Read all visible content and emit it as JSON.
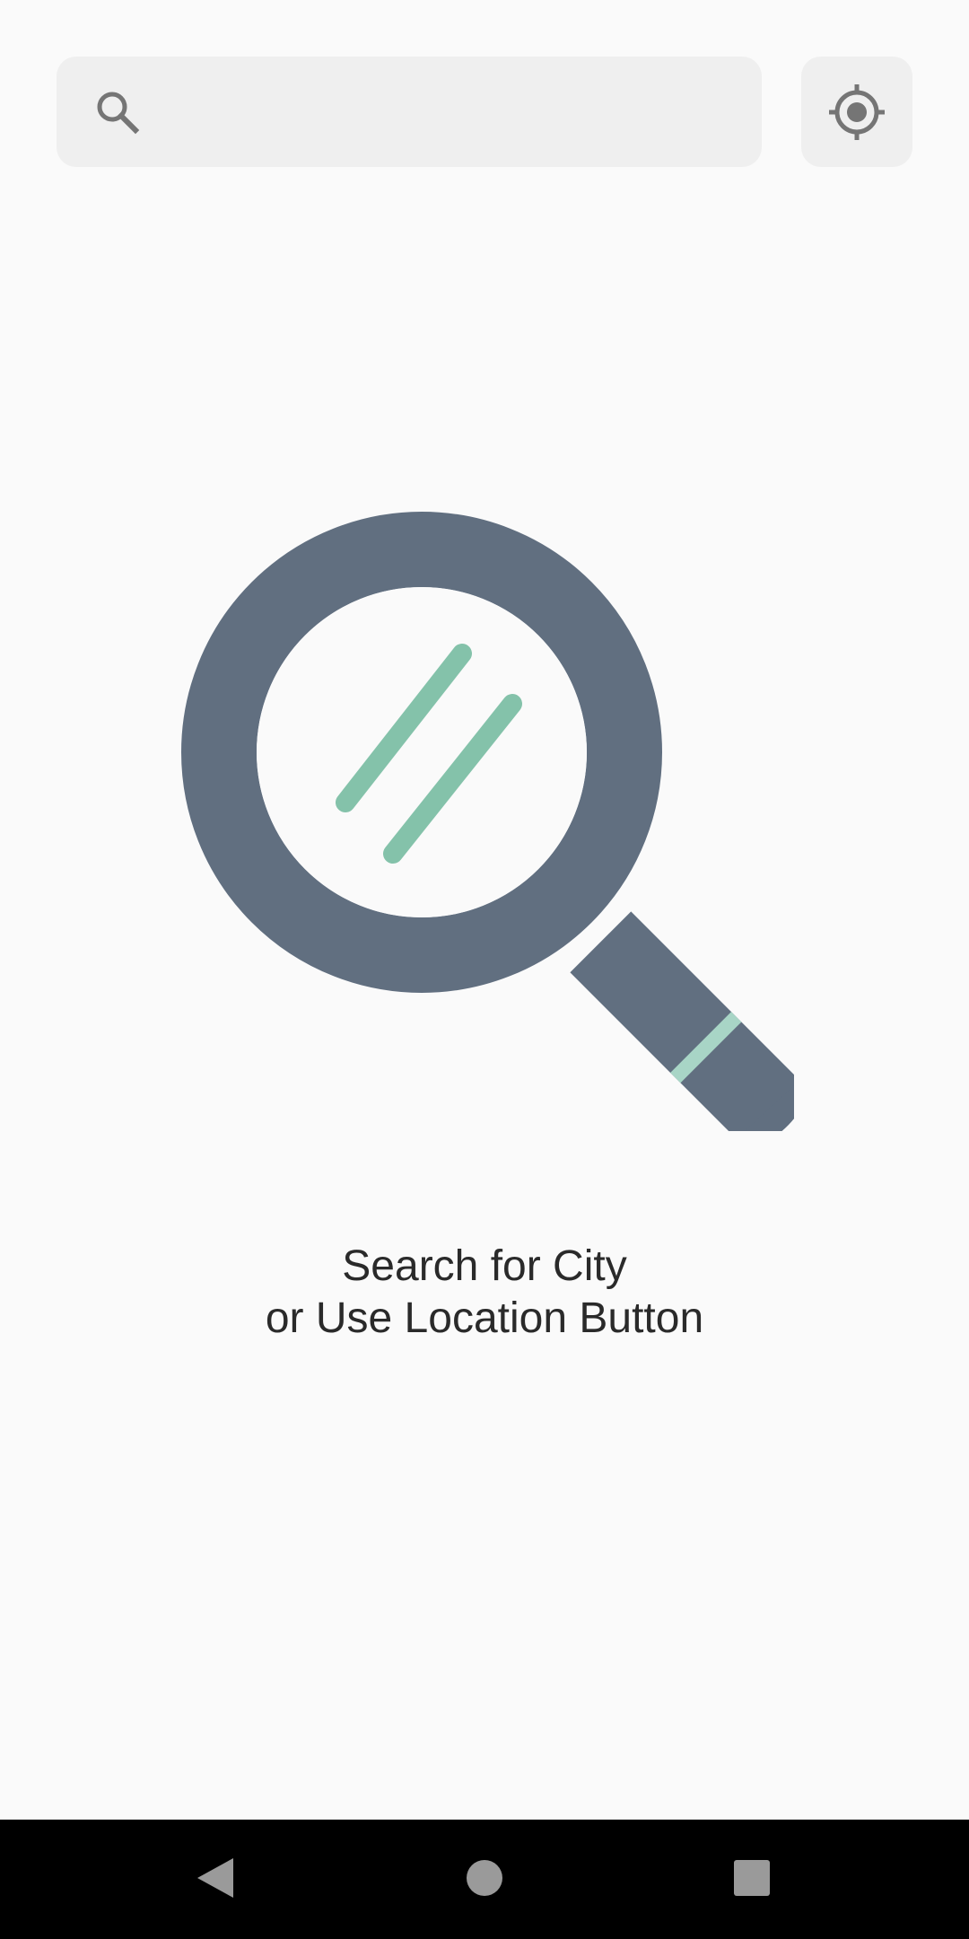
{
  "search": {
    "value": "",
    "placeholder": "",
    "icon": "search-icon"
  },
  "location_button": {
    "icon": "gps-location-icon"
  },
  "empty_state": {
    "illustration": "magnifying-glass-illustration",
    "line1": "Search for City",
    "line2": "or Use Location Button"
  },
  "colors": {
    "background": "#fafafa",
    "field_background": "#efefef",
    "icon_gray": "#757575",
    "illustration_handle": "#616f80",
    "illustration_accent": "#84c2aa",
    "illustration_band": "#a8d5c6"
  },
  "nav_bar": {
    "back_icon": "back-triangle-icon",
    "home_icon": "home-circle-icon",
    "recents_icon": "recents-square-icon"
  }
}
